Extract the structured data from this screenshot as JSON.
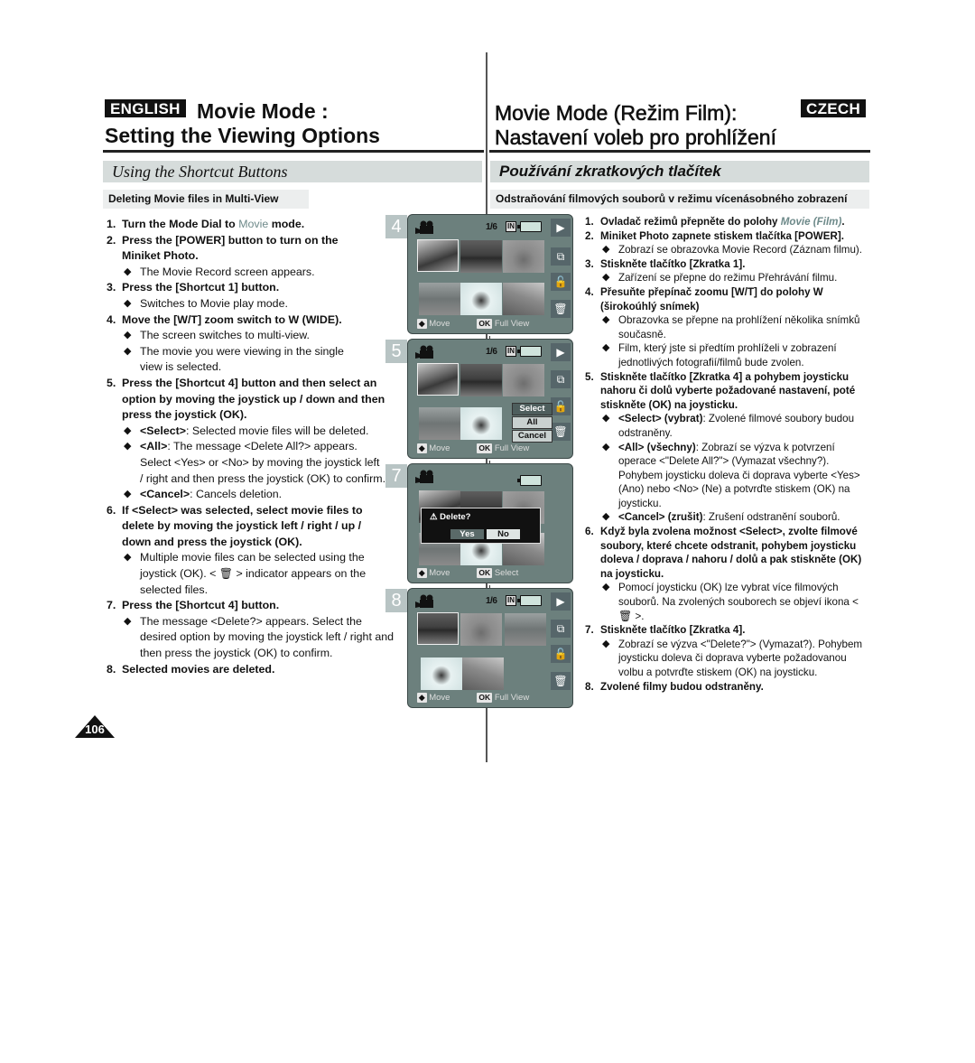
{
  "header": {
    "en_badge": "ENGLISH",
    "en_title_line1": "Movie Mode :",
    "en_title_line2": "Setting the Viewing Options",
    "cz_badge": "CZECH",
    "cz_title_line1": "Movie Mode (Režim Film):",
    "cz_title_line2": "Nastavení voleb pro prohlížení"
  },
  "english": {
    "section_title": "Using the Shortcut Buttons",
    "subsection_title": "Deleting Movie files in Multi-View",
    "steps": [
      {
        "num": "1.",
        "text_before": "Turn the Mode Dial to ",
        "highlight": "Movie",
        "text_after": " mode."
      },
      {
        "num": "2.",
        "line1": "Press the [POWER] button to turn on the",
        "line2": "Miniket Photo.",
        "bullets": [
          "The Movie Record screen appears."
        ]
      },
      {
        "num": "3.",
        "text": "Press the [Shortcut 1] button.",
        "bullets": [
          "Switches to Movie play mode."
        ]
      },
      {
        "num": "4.",
        "text": "Move the [W/T] zoom switch to W (WIDE).",
        "bullets": [
          "The screen switches to multi-view.",
          "The movie you were viewing in the single view is selected."
        ]
      },
      {
        "num": "5.",
        "text": "Press the [Shortcut 4] button and then select an option by moving the joystick up / down and then press the joystick (OK).",
        "bullets": [
          {
            "label": "<Select>",
            "text": ": Selected movie files will be deleted."
          },
          {
            "label": "<All>",
            "text": ": The message <Delete All?> appears. Select <Yes> or <No> by moving the joystick left / right and then press the joystick (OK) to confirm."
          },
          {
            "label": "<Cancel>",
            "text": ": Cancels deletion."
          }
        ]
      },
      {
        "num": "6.",
        "text": "If <Select> was selected, select movie files to delete by moving the joystick left / right / up / down and press the joystick (OK).",
        "bullets": [
          {
            "before": "Multiple movie files can be selected using the joystick (OK). < ",
            "icon": "trash-icon",
            "after": " > indicator appears on the selected files."
          }
        ]
      },
      {
        "num": "7.",
        "text": "Press the [Shortcut 4] button.",
        "bullets": [
          "The message <Delete?> appears. Select the desired option by moving the joystick left / right and then press the joystick (OK) to confirm."
        ]
      },
      {
        "num": "8.",
        "text": "Selected movies are deleted."
      }
    ]
  },
  "czech": {
    "section_title": "Používání zkratkových tlačítek",
    "subsection_title": "Odstraňování filmových souborů v režimu vícenásobného zobrazení",
    "steps": [
      {
        "num": "1.",
        "text_before": "Ovladač režimů přepněte do polohy ",
        "highlight": "Movie (Film)",
        "text_after": "."
      },
      {
        "num": "2.",
        "text": "Miniket Photo zapnete stiskem tlačítka [POWER].",
        "bullets": [
          "Zobrazí se obrazovka Movie Record (Záznam filmu)."
        ]
      },
      {
        "num": "3.",
        "text": "Stiskněte tlačítko [Zkratka 1].",
        "bullets": [
          "Zařízení se přepne do režimu Přehrávání filmu."
        ]
      },
      {
        "num": "4.",
        "text": "Přesuňte přepínač zoomu [W/T] do polohy W",
        "text_normal": "(širokoúhlý snímek)",
        "bullets": [
          "Obrazovka se přepne na prohlížení několika snímků současně.",
          "Film, který jste si předtím prohlíželi v  zobrazení jednotlivých fotografií/filmů bude zvolen."
        ]
      },
      {
        "num": "5.",
        "text": "Stiskněte tlačítko [Zkratka 4] a pohybem joysticku nahoru či dolů vyberte požadované nastavení, poté stiskněte (OK) na joysticku.",
        "bullets": [
          {
            "label": "<Select> (vybrat)",
            "text": ": Zvolené filmové soubory budou odstraněny."
          },
          {
            "label": "<All> (všechny)",
            "text": ": Zobrazí se výzva k potvrzení operace <\"Delete All?\"> (Vymazat všechny?). Pohybem joysticku doleva či doprava vyberte <Yes> (Ano) nebo <No> (Ne) a potvrďte stiskem (OK) na joysticku."
          },
          {
            "label": "<Cancel> (zrušit)",
            "text": ": Zrušení odstranění souborů."
          }
        ]
      },
      {
        "num": "6.",
        "text": "Když byla zvolena možnost <Select>, zvolte filmové soubory, které chcete odstranit, pohybem joysticku doleva / doprava / nahoru / dolů a pak stiskněte (OK) na joysticku.",
        "bullets": [
          {
            "before": "Pomocí joysticku (OK) lze vybrat více filmových souborů. Na zvolených souborech se objeví ikona < ",
            "icon": "trash-icon",
            "after": " >."
          }
        ]
      },
      {
        "num": "7.",
        "text": "Stiskněte tlačítko [Zkratka 4].",
        "bullets": [
          "Zobrazí se výzva <\"Delete?\"> (Vymazat?). Pohybem joysticku doleva či doprava vyberte požadovanou volbu a potvrďte stiskem (OK) na joysticku."
        ]
      },
      {
        "num": "8.",
        "text": "Zvolené filmy budou odstraněny."
      }
    ]
  },
  "screens": [
    {
      "step": "4",
      "counter": "1/6",
      "storage": "IN",
      "foot_move": "Move",
      "foot_ok_key": "OK",
      "foot_ok_label": "Full View"
    },
    {
      "step": "5",
      "counter": "1/6",
      "storage": "IN",
      "menu": [
        "Select",
        "All",
        "Cancel"
      ],
      "menu_active": "Select",
      "foot_move": "Move",
      "foot_ok_key": "OK",
      "foot_ok_label": "Full View"
    },
    {
      "step": "7",
      "dialog_message": "Delete?",
      "dialog_yes": "Yes",
      "dialog_no": "No",
      "foot_move": "Move",
      "foot_ok_key": "OK",
      "foot_ok_label": "Select"
    },
    {
      "step": "8",
      "counter": "1/6",
      "storage": "IN",
      "foot_move": "Move",
      "foot_ok_key": "OK",
      "foot_ok_label": "Full View"
    }
  ],
  "side_icons": [
    "play-icon",
    "slideshow-icon",
    "lock-icon",
    "trash-icon"
  ],
  "colors": {
    "screen_bg": "#6c807d",
    "accent_movie": "#6e8a8a",
    "section_bar": "#d6dcdb"
  },
  "page_number": "106"
}
